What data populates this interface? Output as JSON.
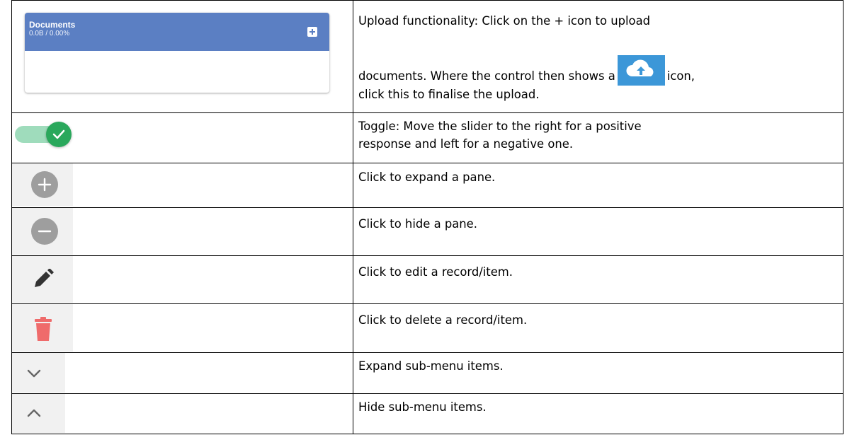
{
  "rows": [
    {
      "widget": {
        "title": "Documents",
        "size": "0.0B / 0.00%"
      },
      "desc_lines": [
        "Upload functionality: Click on the + icon to upload",
        "documents. Where the control then shows a",
        "icon,",
        "click this to finalise the upload."
      ]
    },
    {
      "desc_lines": [
        "Toggle: Move the slider to the right for a positive",
        "response and left for a negative one."
      ]
    },
    {
      "desc": "Click to expand a pane."
    },
    {
      "desc": "Click to hide a pane."
    },
    {
      "desc": "Click to edit a record/item."
    },
    {
      "desc": "Click to delete a record/item."
    },
    {
      "desc": "Expand sub-menu items."
    },
    {
      "desc": "Hide sub-menu items."
    }
  ],
  "icons": {
    "upload": "cloud-upload-icon",
    "toggle": "toggle-switch-on",
    "expand": "plus-circle-icon",
    "hide": "minus-circle-icon",
    "edit": "pencil-icon",
    "delete": "trash-icon",
    "submenu_expand": "chevron-down-icon",
    "submenu_hide": "chevron-up-icon"
  },
  "colors": {
    "card_header": "#5b7fc3",
    "upload_bg": "#3c97d8",
    "toggle_track": "#9fdcbc",
    "toggle_knob": "#2aa85c",
    "circle_icon": "#9e9e9e",
    "pencil": "#333333",
    "trash": "#ef6b6b",
    "chevron": "#666666"
  }
}
